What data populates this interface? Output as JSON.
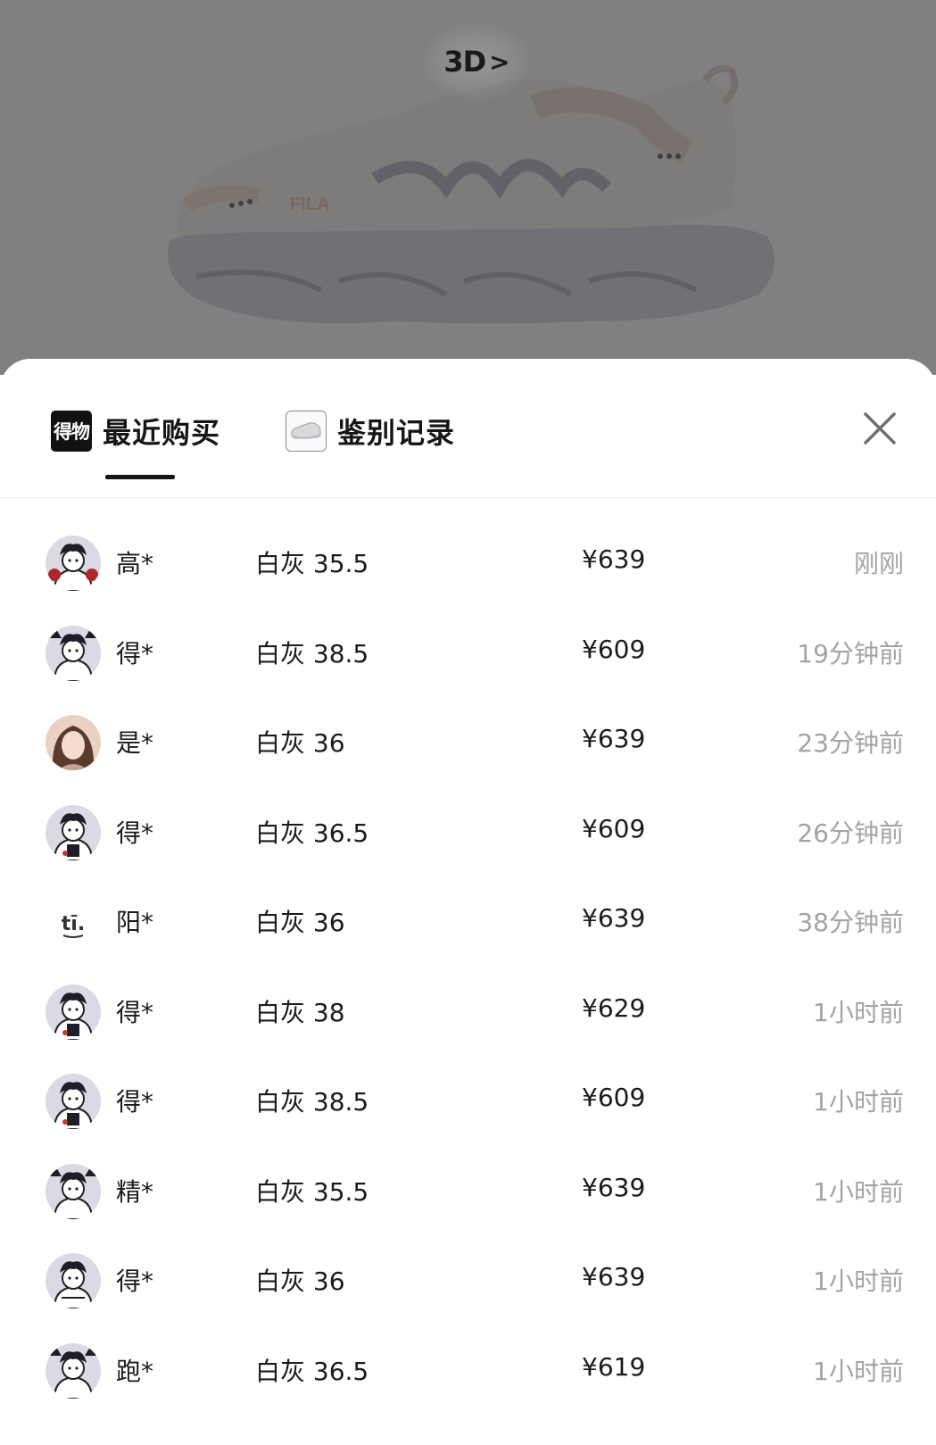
{
  "hero": {
    "view_3d_label": "3D",
    "view_3d_chevron": ">",
    "brand_on_shoe": "FILA"
  },
  "tabs": {
    "recent_icon_text": "得物",
    "recent_label": "最近购买",
    "auth_label": "鉴别记录"
  },
  "purchases": [
    {
      "name": "高*",
      "spec": "白灰 35.5",
      "price": "¥639",
      "time": "刚刚",
      "avatar": "cartoon-a"
    },
    {
      "name": "得*",
      "spec": "白灰 38.5",
      "price": "¥609",
      "time": "19分钟前",
      "avatar": "cartoon-b"
    },
    {
      "name": "是*",
      "spec": "白灰 36",
      "price": "¥639",
      "time": "23分钟前",
      "avatar": "photo"
    },
    {
      "name": "得*",
      "spec": "白灰 36.5",
      "price": "¥609",
      "time": "26分钟前",
      "avatar": "cartoon-c"
    },
    {
      "name": "阳*",
      "spec": "白灰 36",
      "price": "¥639",
      "time": "38分钟前",
      "avatar": "doodle"
    },
    {
      "name": "得*",
      "spec": "白灰 38",
      "price": "¥629",
      "time": "1小时前",
      "avatar": "cartoon-c"
    },
    {
      "name": "得*",
      "spec": "白灰 38.5",
      "price": "¥609",
      "time": "1小时前",
      "avatar": "cartoon-c"
    },
    {
      "name": "精*",
      "spec": "白灰 35.5",
      "price": "¥639",
      "time": "1小时前",
      "avatar": "cartoon-b"
    },
    {
      "name": "得*",
      "spec": "白灰 36",
      "price": "¥639",
      "time": "1小时前",
      "avatar": "cartoon-d"
    },
    {
      "name": "跑*",
      "spec": "白灰 36.5",
      "price": "¥619",
      "time": "1小时前",
      "avatar": "cartoon-b"
    }
  ],
  "colors": {
    "overlay": "#000000",
    "text_primary": "#1b1b1b",
    "text_muted": "#a3a3a3",
    "tab_underline": "#161616"
  }
}
